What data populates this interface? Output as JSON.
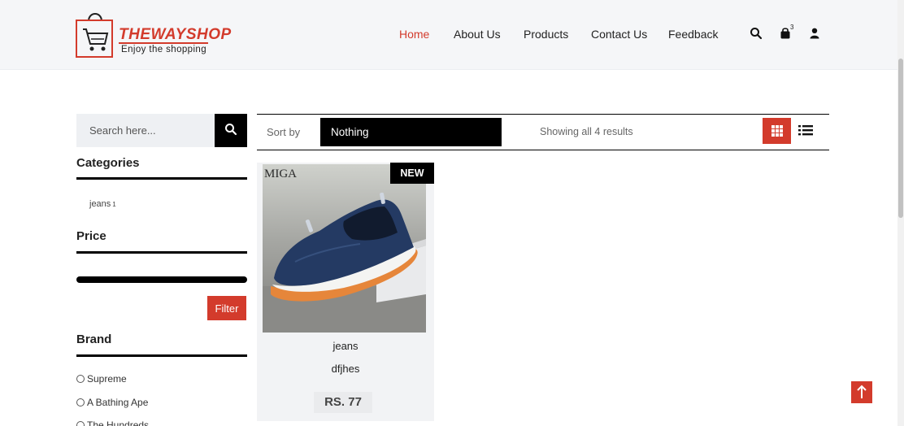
{
  "brand": {
    "name": "THEWAYSHOP",
    "tagline": "Enjoy the shopping"
  },
  "nav": {
    "items": [
      "Home",
      "About Us",
      "Products",
      "Contact Us",
      "Feedback"
    ],
    "active": "Home",
    "cart_count": "3",
    "icons": [
      "search-icon",
      "shopping-bag-icon",
      "user-icon"
    ]
  },
  "sidebar": {
    "search_placeholder": "Search here...",
    "categories_title": "Categories",
    "categories": [
      {
        "label": "jeans",
        "count": "1"
      }
    ],
    "price_title": "Price",
    "filter_label": "Filter",
    "brand_title": "Brand",
    "brands": [
      "Supreme",
      "A Bathing Ape",
      "The Hundreds"
    ]
  },
  "toolbar": {
    "sort_label": "Sort by",
    "sort_value": "Nothing",
    "result_text": "Showing all 4 results",
    "view_modes": [
      "grid-view",
      "list-view"
    ],
    "active_view": "grid-view"
  },
  "products": [
    {
      "badge": "NEW",
      "image_watermark": "MIGA",
      "category": "jeans",
      "name": "dfjhes",
      "price": "RS. 77"
    }
  ],
  "colors": {
    "accent": "#d33b2c",
    "dark": "#000000",
    "header_bg": "#f5f6f8"
  }
}
